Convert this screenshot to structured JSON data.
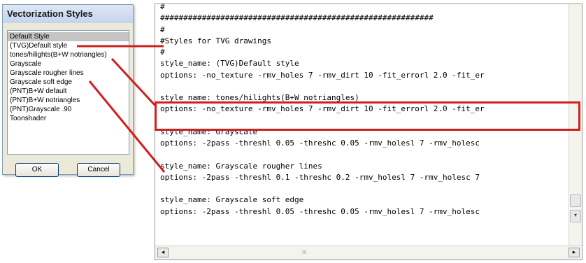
{
  "dialog": {
    "title": "Vectorization Styles",
    "styles": [
      "Default Style",
      "(TVG)Default style",
      "tones/hilights(B+W notriangles)",
      "Grayscale",
      "Grayscale rougher lines",
      "Grayscale soft edge",
      "(PNT)B+W default",
      "(PNT)B+W notriangles",
      "(PNT)Grayscale .90",
      "Toonshader"
    ],
    "selected_index": 0,
    "ok_label": "OK",
    "cancel_label": "Cancel"
  },
  "editor": {
    "lines": [
      "#",
      "###########################################################",
      "#",
      "#Styles for TVG drawings",
      "#",
      "style_name: (TVG)Default style",
      "options: -no_texture -rmv_holes 7 -rmv_dirt 10 -fit_errorl 2.0 -fit_er",
      "",
      "style_name: tones/hilights(B+W notriangles)",
      "options: -no_texture -rmv_holes 7 -rmv_dirt 10 -fit_errorl 2.0 -fit_er",
      "",
      "style_name: Grayscale",
      "options: -2pass -threshl 0.05 -threshc 0.05 -rmv_holesl 7 -rmv_holesc",
      "",
      "style_name: Grayscale rougher lines",
      "options: -2pass -threshl 0.1 -threshc 0.2 -rmv_holesl 7 -rmv_holesc 7",
      "",
      "style_name: Grayscale soft edge",
      "options: -2pass -threshl 0.05 -threshc 0.05 -rmv_holesl 7 -rmv_holesc",
      ""
    ],
    "scroll_grip": "III"
  },
  "colors": {
    "callout": "#d11f1f",
    "dialog_bg": "#ece9d8",
    "selection": "#c4c4c4"
  }
}
